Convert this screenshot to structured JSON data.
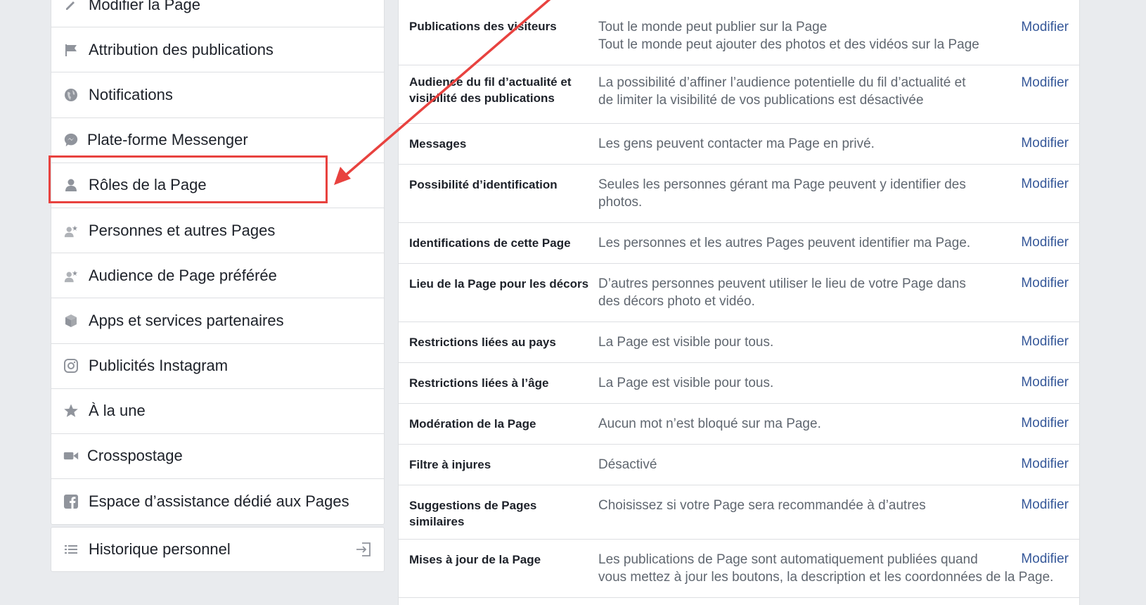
{
  "sidebar": {
    "items": [
      {
        "label": "Modifier la Page",
        "icon": "pencil-icon"
      },
      {
        "label": "Attribution des publications",
        "icon": "flag-icon"
      },
      {
        "label": "Notifications",
        "icon": "globe-icon"
      },
      {
        "label": "Plate-forme Messenger",
        "icon": "messenger-icon"
      },
      {
        "label": "Rôles de la Page",
        "icon": "person-icon"
      },
      {
        "label": "Personnes et autres Pages",
        "icon": "person-star-icon"
      },
      {
        "label": "Audience de Page préférée",
        "icon": "person-star-icon"
      },
      {
        "label": "Apps et services partenaires",
        "icon": "cube-icon"
      },
      {
        "label": "Publicités Instagram",
        "icon": "instagram-icon"
      },
      {
        "label": "À la une",
        "icon": "star-icon"
      },
      {
        "label": "Crosspostage",
        "icon": "video-camera-icon"
      },
      {
        "label": "Espace d’assistance dédié aux Pages",
        "icon": "facebook-icon"
      }
    ],
    "history_label": "Historique personnel"
  },
  "settings": {
    "edit_label": "Modifier",
    "rows": [
      {
        "title": "Publications des visiteurs",
        "desc": [
          "Tout le monde peut publier sur la Page",
          "Tout le monde peut ajouter des photos et des vidéos sur la Page"
        ]
      },
      {
        "title": "Audience du fil d’actualité et visibilité des publications",
        "desc": [
          "La possibilité d’affiner l’audience potentielle du fil d’actualité et",
          "de limiter la visibilité de vos publications est désactivée"
        ]
      },
      {
        "title": "Messages",
        "desc": [
          "Les gens peuvent contacter ma Page en privé."
        ]
      },
      {
        "title": "Possibilité d’identification",
        "desc": [
          "Seules les personnes gérant ma Page peuvent y identifier des",
          "photos."
        ]
      },
      {
        "title": "Identifications de cette Page",
        "desc": [
          "Les personnes et les autres Pages peuvent identifier ma Page."
        ]
      },
      {
        "title": "Lieu de la Page pour les décors",
        "desc": [
          "D’autres personnes peuvent utiliser le lieu de votre Page dans",
          "des décors photo et vidéo."
        ]
      },
      {
        "title": "Restrictions liées au pays",
        "desc": [
          "La Page est visible pour tous."
        ]
      },
      {
        "title": "Restrictions liées à l’âge",
        "desc": [
          "La Page est visible pour tous."
        ]
      },
      {
        "title": "Modération de la Page",
        "desc": [
          "Aucun mot n’est bloqué sur ma Page."
        ]
      },
      {
        "title": "Filtre à injures",
        "desc": [
          "Désactivé"
        ]
      },
      {
        "title": "Suggestions de Pages similaires",
        "desc": [
          "Choisissez si votre Page sera recommandée à d’autres"
        ]
      },
      {
        "title": "Mises à jour de la Page",
        "desc": [
          "Les publications de Page sont automatiquement publiées quand",
          "vous mettez à jour les boutons, la description et les coordonnées de la Page."
        ]
      }
    ]
  },
  "colors": {
    "background": "#e9ebee",
    "link": "#365899",
    "annotation_red": "#e8423f",
    "icon_gray": "#90949c"
  }
}
